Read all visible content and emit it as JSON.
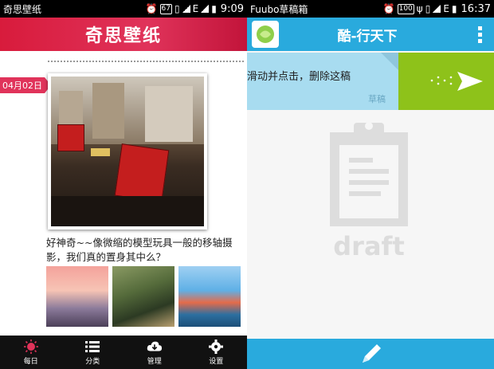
{
  "left": {
    "status": {
      "app": "奇思壁纸",
      "battery": "67",
      "net": "E",
      "time": "9:09"
    },
    "header": {
      "title": "奇思壁纸"
    },
    "date_tag": "04月02日",
    "caption": "好神奇~~像微缩的模型玩具一般的移轴摄影，我们真的置身其中么？",
    "nav": [
      {
        "label": "每日",
        "icon": "sun-icon",
        "color": "#e0335a"
      },
      {
        "label": "分类",
        "icon": "list-icon",
        "color": "#ffffff"
      },
      {
        "label": "管理",
        "icon": "cloud-download-icon",
        "color": "#ffffff"
      },
      {
        "label": "设置",
        "icon": "gear-icon",
        "color": "#ffffff"
      }
    ]
  },
  "right": {
    "status": {
      "app": "Fuubo草稿箱",
      "battery": "100",
      "net": "E",
      "time": "16:37"
    },
    "header": {
      "title": "酷-行天下"
    },
    "draft": {
      "text": "滑动并点击，删除这稿",
      "label": "草稿"
    },
    "empty_label": "draft",
    "colors": {
      "accent": "#29aadd",
      "send": "#8ec21a",
      "card": "#a8dcf0"
    }
  }
}
